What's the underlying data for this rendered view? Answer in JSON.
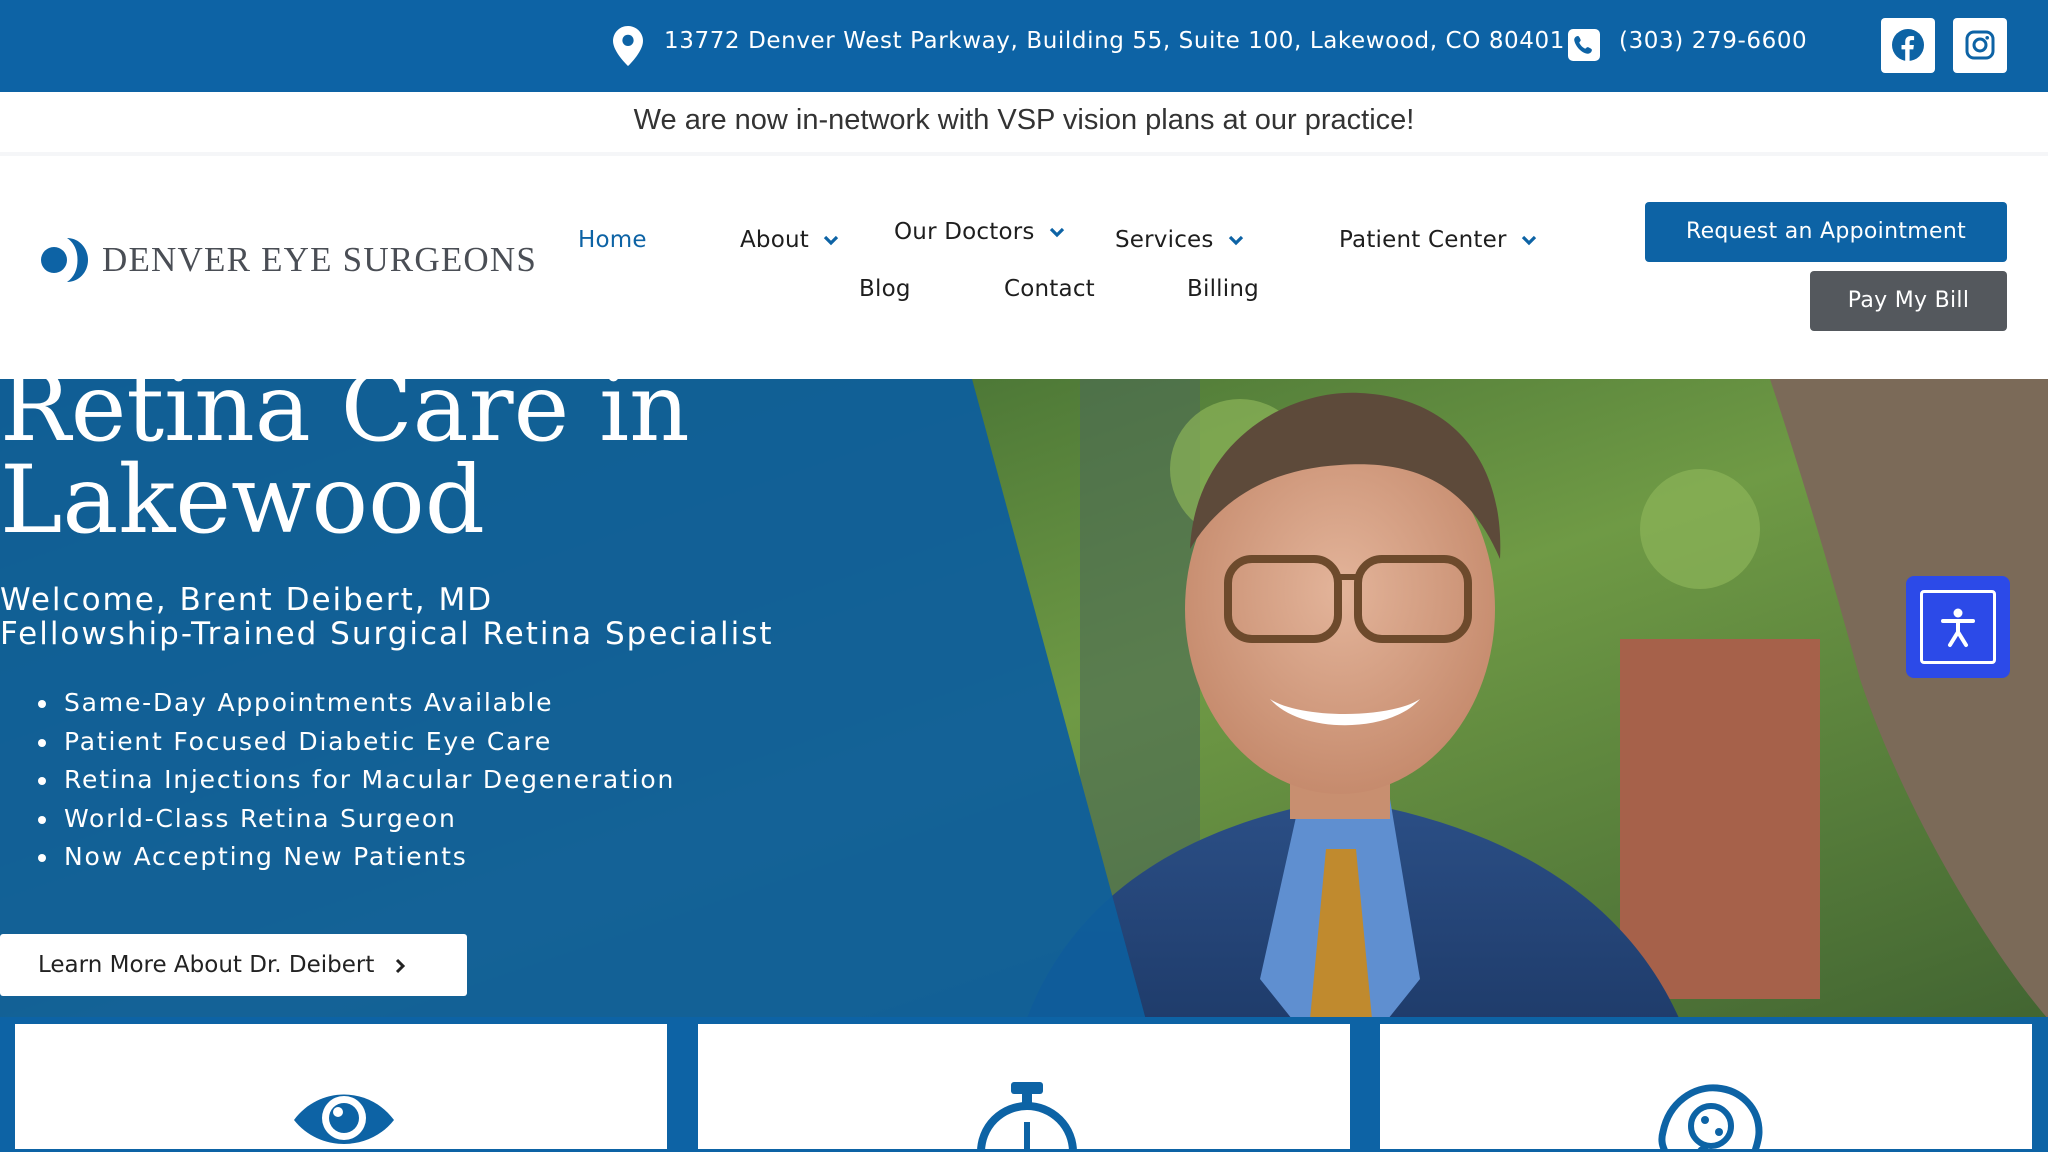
{
  "topbar": {
    "address": "13772 Denver West Parkway, Building 55, Suite 100, Lakewood, CO 80401",
    "phone": "(303) 279-6600",
    "social": [
      "facebook-icon",
      "instagram-icon"
    ]
  },
  "announcement": "We are now in-network with VSP vision plans at our practice!",
  "brand": {
    "name": "DENVER EYE SURGEONS"
  },
  "nav": {
    "home": "Home",
    "about": "About",
    "our_doctors": "Our Doctors",
    "services": "Services",
    "patient_center": "Patient Center",
    "blog": "Blog",
    "contact": "Contact",
    "billing": "Billing"
  },
  "cta": {
    "request": "Request an Appointment",
    "pay": "Pay My Bill"
  },
  "hero": {
    "title_line1": "Retina Care in",
    "title_line2": "Lakewood",
    "welcome": "Welcome, Brent Deibert, MD",
    "specialty": "Fellowship-Trained Surgical Retina Specialist",
    "bullets": [
      "Same-Day Appointments Available",
      "Patient Focused Diabetic Eye Care",
      "Retina Injections for Macular Degeneration",
      "World-Class Retina Surgeon",
      "Now Accepting New Patients"
    ],
    "button": "Learn More About Dr. Deibert"
  },
  "colors": {
    "brand_blue": "#0d63a5",
    "dark_gray": "#54585d",
    "a11y_blue": "#2c4ae8"
  },
  "cards": [
    {
      "icon": "eye-icon"
    },
    {
      "icon": "stopwatch-icon"
    },
    {
      "icon": "head-brain-icon"
    }
  ]
}
